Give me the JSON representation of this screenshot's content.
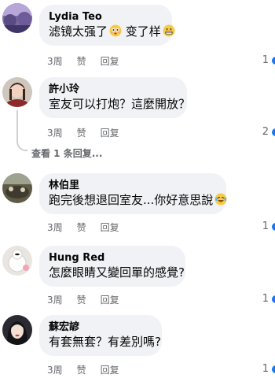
{
  "comments": [
    {
      "name": "Lydia Teo",
      "text": "滤镜太强了",
      "emoji1": "flushed-emoji",
      "text2": " 变了样",
      "emoji2": "grimace-emoji",
      "time": "3周",
      "like": "赞",
      "reply": "回复",
      "reactions": "1"
    },
    {
      "name": "許小玲",
      "text": "室友可以打炮？這麼開放？",
      "time": "3周",
      "like": "赞",
      "reply": "回复",
      "reactions": "2"
    },
    {
      "name": "林伯里",
      "text": "跑完後想退回室友...你好意思說",
      "emoji1": "laughing-tears-emoji",
      "time": "3周",
      "like": "赞",
      "reply": "回复",
      "reactions": "1"
    },
    {
      "name": "Hung Red",
      "text": "怎麼眼睛又變回單的感覺?",
      "time": "3周",
      "like": "赞",
      "reply": "回复",
      "reactions": "1"
    },
    {
      "name": "蘇宏諺",
      "text": "有套無套？有差別嗎?",
      "time": "3周",
      "like": "赞",
      "reply": "回复",
      "reactions": "1"
    }
  ],
  "view_replies": "查看 1 条回复...",
  "colors": {
    "bubble": "#f0f2f5",
    "meta": "#65676b",
    "reaction": "#1877f2"
  }
}
